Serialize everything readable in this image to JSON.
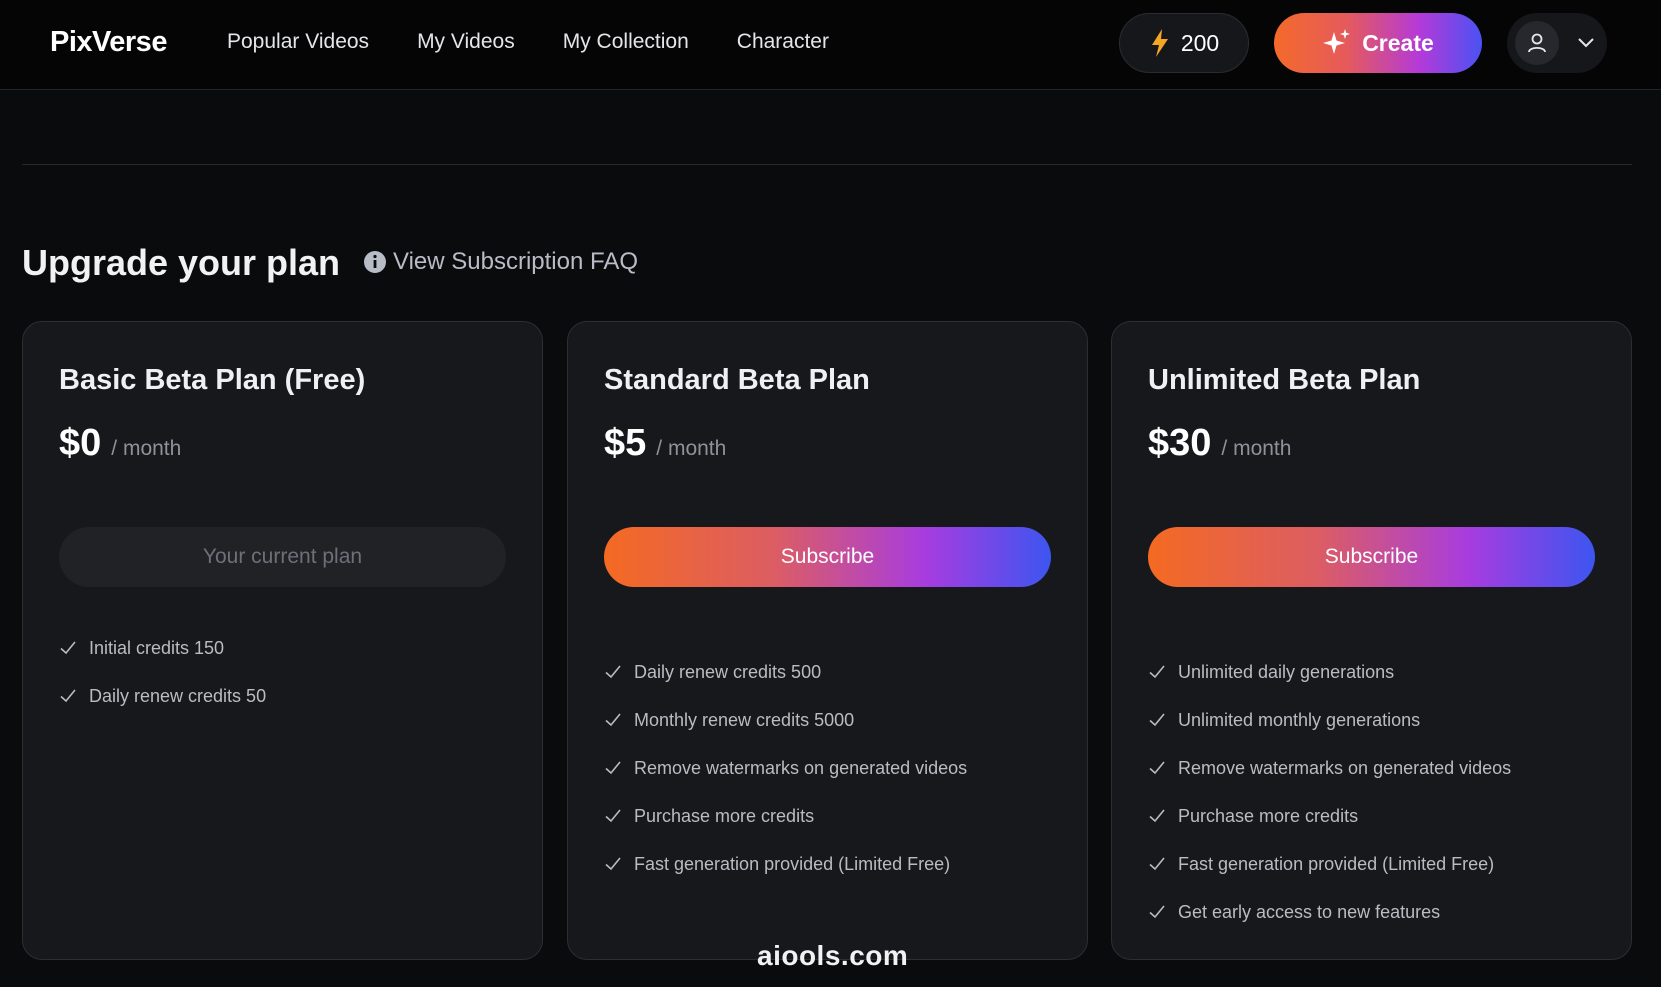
{
  "header": {
    "logo": "PixVerse",
    "nav": [
      "Popular Videos",
      "My Videos",
      "My Collection",
      "Character"
    ],
    "credits": "200",
    "create_label": "Create"
  },
  "page": {
    "title": "Upgrade your plan",
    "faq_link": "View Subscription FAQ"
  },
  "plans": [
    {
      "title": "Basic Beta Plan (Free)",
      "price": "$0",
      "period": "/ month",
      "button": "Your current plan",
      "features": [
        "Initial credits 150",
        "Daily renew credits 50"
      ]
    },
    {
      "title": "Standard Beta Plan",
      "price": "$5",
      "period": "/ month",
      "button": "Subscribe",
      "features": [
        "Daily renew credits 500",
        "Monthly renew credits 5000",
        "Remove watermarks on generated videos",
        "Purchase more credits",
        "Fast generation provided (Limited Free)"
      ]
    },
    {
      "title": "Unlimited Beta Plan",
      "price": "$30",
      "period": "/ month",
      "button": "Subscribe",
      "features": [
        "Unlimited daily generations",
        "Unlimited monthly generations",
        "Remove watermarks on generated videos",
        "Purchase more credits",
        "Fast generation provided (Limited Free)",
        "Get early access to new features"
      ]
    }
  ],
  "watermark": "aiools.com",
  "colors": {
    "background": "#0a0b0d",
    "card": "#17181c",
    "gradient_start": "#f46a22",
    "gradient_mid": "#a73ce0",
    "gradient_end": "#3d55f0",
    "bolt": "#f5a623"
  },
  "icons": [
    "lightning-icon",
    "sparkle-icon",
    "user-icon",
    "chevron-down-icon",
    "info-icon",
    "check-icon"
  ]
}
